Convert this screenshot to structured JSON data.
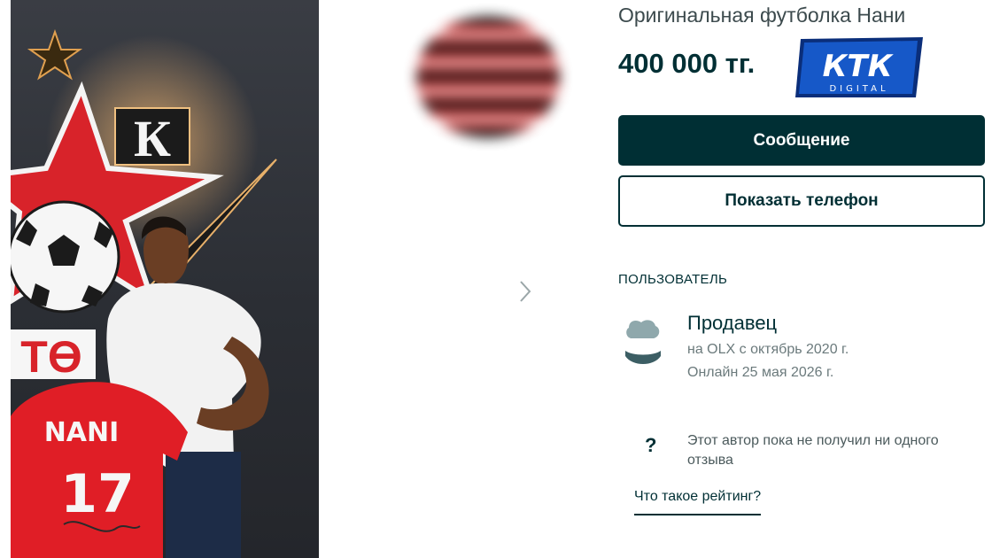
{
  "listing": {
    "title": "Оригинальная футболка Нани",
    "price": "400 000 тг."
  },
  "actions": {
    "message_label": "Сообщение",
    "phone_label": "Показать телефон"
  },
  "user": {
    "section_label": "ПОЛЬЗОВАТЕЛЬ",
    "name": "Продавец",
    "since": "на OLX с октябрь 2020 г.",
    "online": "Онлайн 25 мая 2026 г."
  },
  "reviews": {
    "icon_glyph": "?",
    "text": "Этот автор пока не получил ни одного отзыва",
    "rating_link": "Что такое рейтинг?"
  },
  "photo": {
    "crest_letter": "К",
    "crest_text": "ТӨ",
    "jersey_name": "NANI",
    "jersey_number": "17"
  },
  "watermark": {
    "text": "КТК",
    "subtext": "DIGITAL"
  },
  "gallery": {
    "next_icon": "chevron-right-icon"
  },
  "colors": {
    "primary": "#002f34",
    "jersey_red": "#e01e26",
    "shirt_white": "#f2f2f2"
  }
}
